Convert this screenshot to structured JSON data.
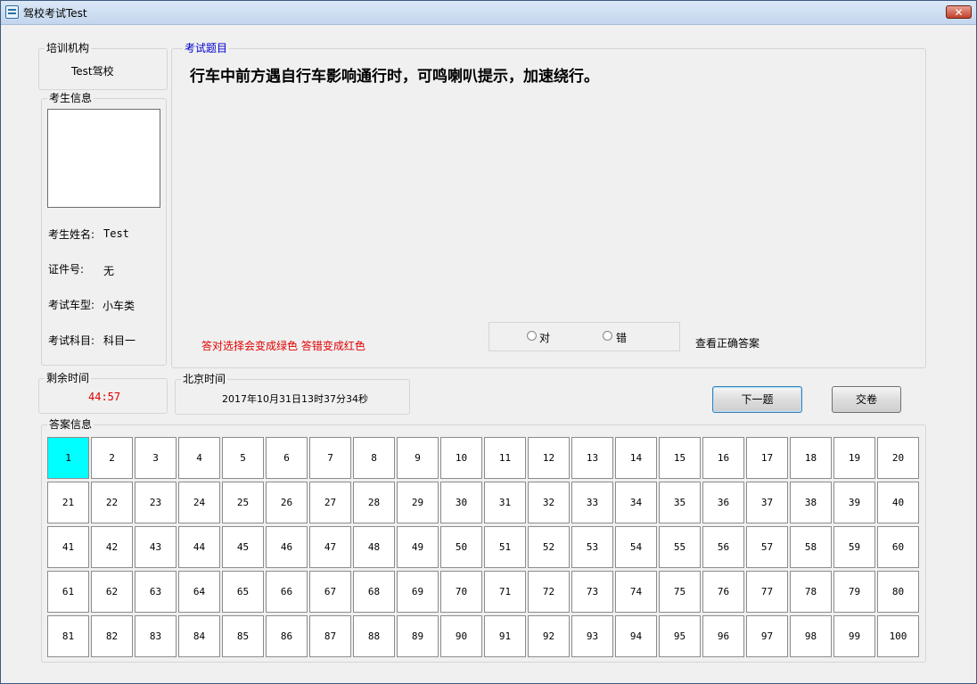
{
  "window": {
    "title": "驾校考试Test",
    "close_label": "✕"
  },
  "org": {
    "legend": "培训机构",
    "name": "Test驾校"
  },
  "student": {
    "legend": "考生信息",
    "name_label": "考生姓名:",
    "name": "Test",
    "id_label": "证件号:",
    "id": "无",
    "vehicle_label": "考试车型:",
    "vehicle": "小车类",
    "subject_label": "考试科目:",
    "subject": "科目一"
  },
  "question": {
    "legend": "考试题目",
    "text": "行车中前方遇自行车影响通行时，可鸣喇叭提示，加速绕行。",
    "hint": "答对选择会变成绿色 答错变成红色",
    "options": [
      {
        "label": "对",
        "selected": false
      },
      {
        "label": "错",
        "selected": false
      }
    ],
    "view_answer": "查看正确答案"
  },
  "timer": {
    "legend": "剩余时间",
    "remaining": "44:57",
    "color": "#e00000"
  },
  "clock": {
    "legend": "北京时间",
    "datetime": "2017年10月31日13时37分34秒"
  },
  "buttons": {
    "next": "下一题",
    "submit": "交卷"
  },
  "answers": {
    "legend": "答案信息",
    "current": 1,
    "current_color": "#00ffff",
    "total": 100,
    "numbers": [
      "1",
      "2",
      "3",
      "4",
      "5",
      "6",
      "7",
      "8",
      "9",
      "10",
      "11",
      "12",
      "13",
      "14",
      "15",
      "16",
      "17",
      "18",
      "19",
      "20",
      "21",
      "22",
      "23",
      "24",
      "25",
      "26",
      "27",
      "28",
      "29",
      "30",
      "31",
      "32",
      "33",
      "34",
      "35",
      "36",
      "37",
      "38",
      "39",
      "40",
      "41",
      "42",
      "43",
      "44",
      "45",
      "46",
      "47",
      "48",
      "49",
      "50",
      "51",
      "52",
      "53",
      "54",
      "55",
      "56",
      "57",
      "58",
      "59",
      "60",
      "61",
      "62",
      "63",
      "64",
      "65",
      "66",
      "67",
      "68",
      "69",
      "70",
      "71",
      "72",
      "73",
      "74",
      "75",
      "76",
      "77",
      "78",
      "79",
      "80",
      "81",
      "82",
      "83",
      "84",
      "85",
      "86",
      "87",
      "88",
      "89",
      "90",
      "91",
      "92",
      "93",
      "94",
      "95",
      "96",
      "97",
      "98",
      "99",
      "100"
    ]
  }
}
